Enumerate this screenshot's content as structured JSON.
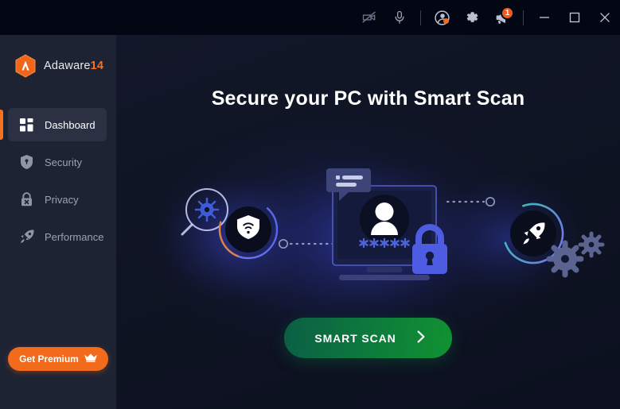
{
  "window": {
    "titlebar": {
      "tools": [
        {
          "name": "webcam-blocked-icon",
          "label": "Webcam Protection"
        },
        {
          "name": "microphone-icon",
          "label": "Microphone Protection"
        },
        {
          "name": "account-icon",
          "label": "Account"
        },
        {
          "name": "gear-icon",
          "label": "Settings"
        },
        {
          "name": "notifications-icon",
          "label": "Notifications",
          "badge": "1"
        }
      ],
      "controls": [
        {
          "name": "minimize-button",
          "label": "Minimize"
        },
        {
          "name": "maximize-button",
          "label": "Maximize"
        },
        {
          "name": "close-button",
          "label": "Close"
        }
      ]
    }
  },
  "sidebar": {
    "brand": {
      "name": "Adaware",
      "version": "14",
      "logo_icon": "adaware-hexagon-logo"
    },
    "items": [
      {
        "label": "Dashboard",
        "icon": "grid-icon",
        "active": true
      },
      {
        "label": "Security",
        "icon": "shield-key-icon",
        "active": false
      },
      {
        "label": "Privacy",
        "icon": "lock-x-icon",
        "active": false
      },
      {
        "label": "Performance",
        "icon": "rocket-icon",
        "active": false
      }
    ],
    "premium": {
      "label": "Get Premium",
      "icon": "crown-icon"
    }
  },
  "main": {
    "headline": "Secure your PC with Smart Scan",
    "cta": {
      "label": "SMART SCAN",
      "icon": "chevron-right-icon"
    },
    "illustration": {
      "name": "smart-scan-illustration",
      "elements": [
        "magnifier-virus-icon",
        "shield-wifi-badge",
        "monitor-with-user-avatar",
        "password-asterisks",
        "chat-bubble-icon",
        "padlock-icon",
        "rocket-badge",
        "gears-icon",
        "dotted-connector-left",
        "dotted-connector-right"
      ],
      "password_mask": "*****"
    }
  },
  "colors": {
    "accent_orange": "#f5721e",
    "scan_green_start": "#0b5e45",
    "scan_green_end": "#119232",
    "sidebar_bg": "#1e2333",
    "titlebar_bg": "#030713",
    "main_bg": "#0f1426",
    "active_item_bg": "#2b3142",
    "badge_red": "#f05a1e"
  }
}
